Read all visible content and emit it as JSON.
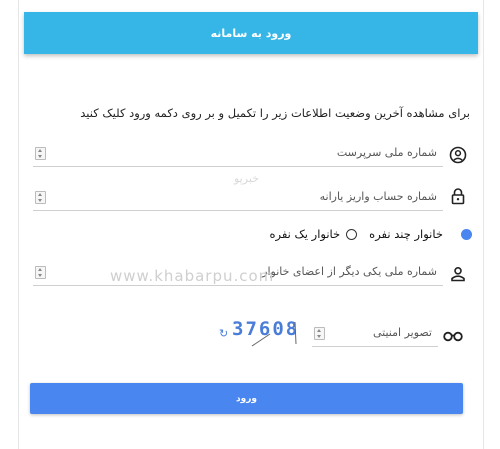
{
  "header": {
    "title": "ورود به سامانه"
  },
  "instruction": "برای مشاهده آخرین وضعیت اطلاعات زیر را تکمیل و بر روی دکمه ورود کلیک کنید",
  "fields": {
    "national_id": {
      "placeholder": "شماره ملی سرپرست",
      "icon": "person-circle-icon"
    },
    "account": {
      "placeholder": "شماره حساب واریز یارانه",
      "icon": "lock-icon"
    },
    "member_id": {
      "placeholder": "شماره ملی یکی دیگر از اعضای خانوار",
      "icon": "person-icon"
    },
    "captcha": {
      "placeholder": "تصویر امنیتی",
      "icon": "glasses-icon"
    }
  },
  "household": {
    "multi_label": "خانوار چند نفره",
    "multi_selected": true,
    "single_label": "خانوار یک نفره",
    "single_selected": false
  },
  "captcha_image": {
    "text": "37608"
  },
  "watermarks": {
    "fa": "خبرپو",
    "en": "www.khabarpu.com"
  },
  "submit": {
    "label": "ورود"
  },
  "colors": {
    "header": "#35b6e6",
    "button": "#4a86f0",
    "captcha": "#4a7dd8"
  }
}
